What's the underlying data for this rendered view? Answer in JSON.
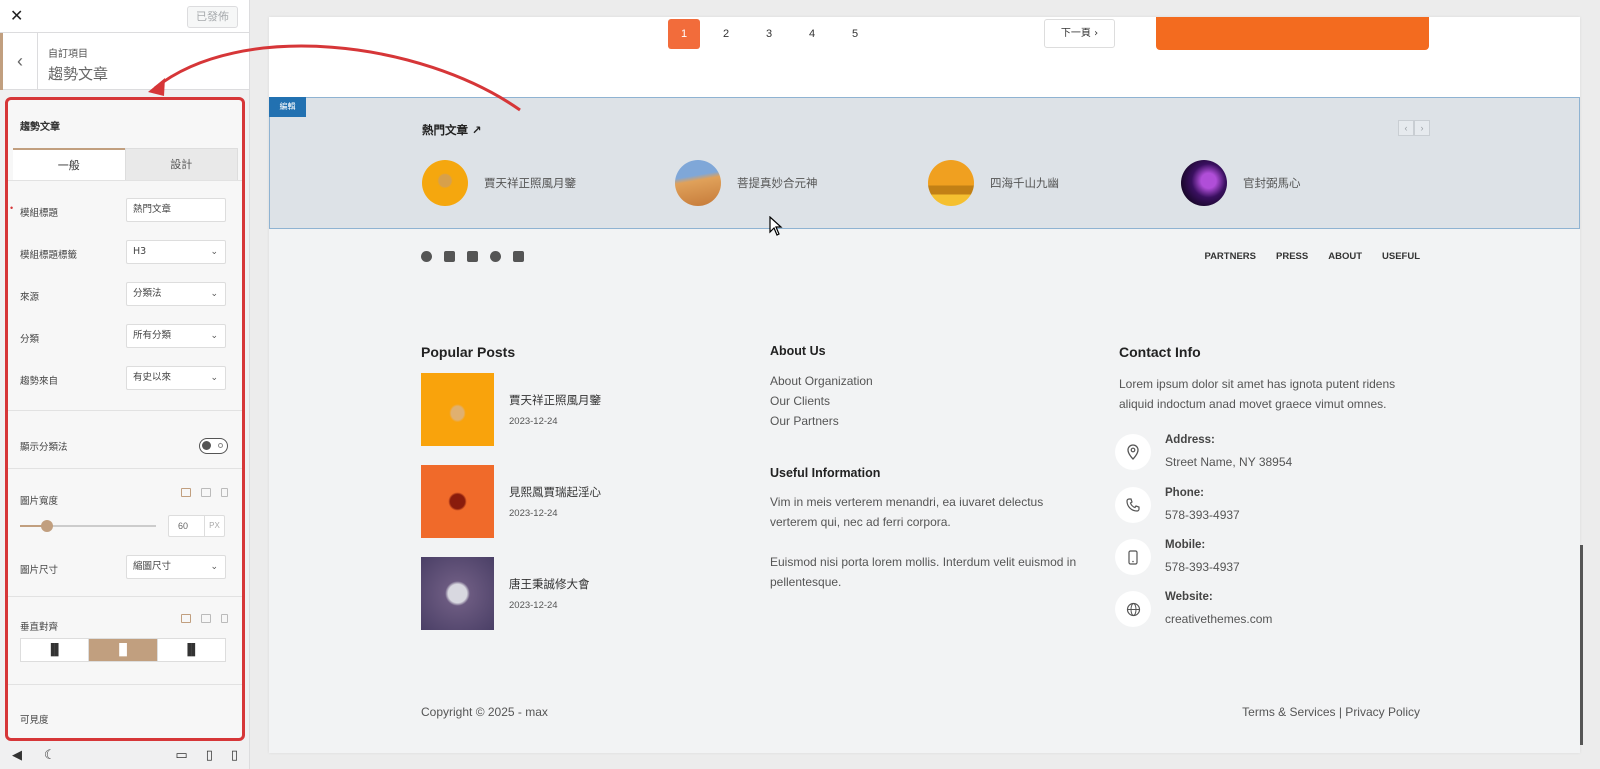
{
  "sidebar": {
    "close": "✕",
    "published_label": "已發佈",
    "breadcrumb": "自訂項目",
    "section_title": "趨勢文章",
    "panel_title": "趨勢文章",
    "tabs": [
      "一般",
      "設計"
    ],
    "fields": {
      "module_title_label": "模組標題",
      "module_title_value": "熱門文章",
      "title_tag_label": "模組標題標籤",
      "title_tag_value": "H3",
      "source_label": "來源",
      "source_value": "分類法",
      "category_label": "分類",
      "category_value": "所有分類",
      "trend_from_label": "趨勢來自",
      "trend_from_value": "有史以來",
      "show_taxonomy_label": "顯示分類法",
      "image_width_label": "圖片寬度",
      "image_width_value": "60",
      "image_width_unit": "PX",
      "image_size_label": "圖片尺寸",
      "image_size_value": "縮圖尺寸",
      "valign_label": "垂直對齊",
      "visibility_label": "可見度"
    },
    "image_width_fraction": 0.2
  },
  "preview": {
    "pagination": [
      "1",
      "2",
      "3",
      "4",
      "5"
    ],
    "next_label": "下一頁 ›",
    "edit_tag": "編輯",
    "trending_title": "熱門文章",
    "trending_posts": [
      "賈天祥正照風月鑒",
      "菩提真妙合元神",
      "四海千山九幽",
      "官封弼馬心"
    ],
    "footer_nav": [
      "PARTNERS",
      "PRESS",
      "ABOUT",
      "USEFUL"
    ],
    "popular_posts_title": "Popular Posts",
    "popular_posts": [
      {
        "title": "賈天祥正照風月鑒",
        "date": "2023-12-24"
      },
      {
        "title": "見熙鳳賈瑞起淫心",
        "date": "2023-12-24"
      },
      {
        "title": "唐王秉誠修大會",
        "date": "2023-12-24"
      }
    ],
    "about_title": "About Us",
    "about_links": [
      "About Organization",
      "Our Clients",
      "Our Partners"
    ],
    "useful_title": "Useful Information",
    "useful_p1": "Vim in meis verterem menandri, ea iuvaret delectus verterem qui, nec ad ferri corpora.",
    "useful_p2": "Euismod nisi porta lorem mollis. Interdum velit euismod in pellentesque.",
    "contact_title": "Contact Info",
    "contact_intro": "Lorem ipsum dolor sit amet has ignota putent ridens aliquid indoctum anad movet graece vimut omnes.",
    "contact": [
      {
        "key": "Address:",
        "value": "Street Name, NY 38954",
        "icon": "map-pin-icon"
      },
      {
        "key": "Phone:",
        "value": "578-393-4937",
        "icon": "phone-icon"
      },
      {
        "key": "Mobile:",
        "value": "578-393-4937",
        "icon": "mobile-icon"
      },
      {
        "key": "Website:",
        "value": "creativethemes.com",
        "icon": "globe-icon"
      }
    ],
    "copyright": "Copyright © 2025 - max",
    "legal": "Terms & Services | Privacy Policy"
  },
  "colors": {
    "accent": "#c19f7f",
    "highlight_border": "#d63638",
    "brand_orange": "#f26c3b",
    "edit_blue": "#2271b1"
  }
}
